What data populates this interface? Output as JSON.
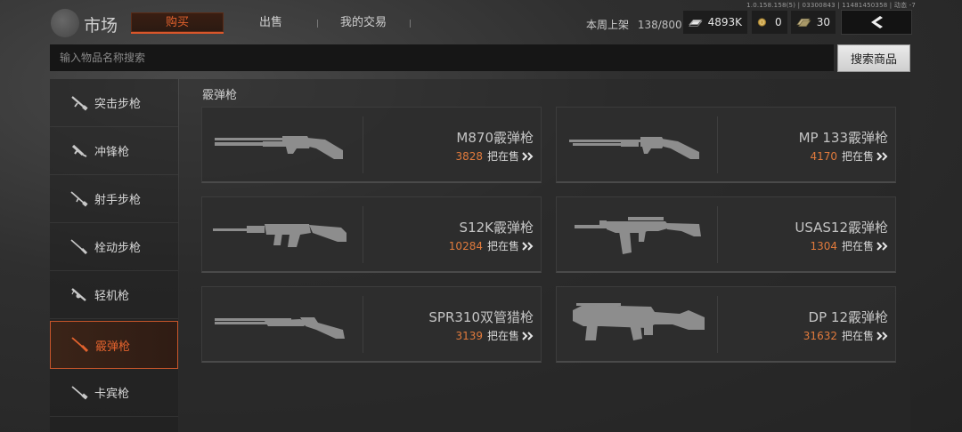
{
  "version_text": "1.0.158.158(5) | 03300843 | 11481450358 | 动态 -7",
  "header": {
    "title": "市场",
    "tabs": [
      {
        "label": "购买",
        "active": true
      },
      {
        "label": "出售",
        "active": false
      },
      {
        "label": "我的交易",
        "active": false
      }
    ],
    "weekly_listing_label": "本周上架",
    "weekly_listing_value": "138/800",
    "currencies": [
      {
        "icon": "cash-stack-icon",
        "value": "4893K"
      },
      {
        "icon": "gold-coin-icon",
        "value": "0"
      },
      {
        "icon": "ticket-bundle-icon",
        "value": "30"
      }
    ]
  },
  "search": {
    "placeholder": "输入物品名称搜索",
    "button_label": "搜索商品"
  },
  "sidebar": {
    "items": [
      {
        "label": "突击步枪",
        "icon": "assault-rifle-icon",
        "active": false
      },
      {
        "label": "冲锋枪",
        "icon": "smg-icon",
        "active": false
      },
      {
        "label": "射手步枪",
        "icon": "marksman-rifle-icon",
        "active": false
      },
      {
        "label": "栓动步枪",
        "icon": "bolt-action-rifle-icon",
        "active": false
      },
      {
        "label": "轻机枪",
        "icon": "lmg-icon",
        "active": false
      },
      {
        "label": "霰弹枪",
        "icon": "shotgun-icon",
        "active": true
      },
      {
        "label": "卡宾枪",
        "icon": "carbine-icon",
        "active": false
      }
    ]
  },
  "main": {
    "section_title": "霰弹枪",
    "on_sale_suffix": "把在售",
    "items": [
      {
        "name": "M870霰弹枪",
        "count": "3828",
        "icon": "pump-shotgun-icon"
      },
      {
        "name": "MP 133霰弹枪",
        "count": "4170",
        "icon": "pump-shotgun-icon"
      },
      {
        "name": "S12K霰弹枪",
        "count": "10284",
        "icon": "semi-auto-shotgun-icon"
      },
      {
        "name": "USAS12霰弹枪",
        "count": "1304",
        "icon": "auto-shotgun-icon"
      },
      {
        "name": "SPR310双管猎枪",
        "count": "3139",
        "icon": "double-barrel-shotgun-icon"
      },
      {
        "name": "DP 12霰弹枪",
        "count": "31632",
        "icon": "bullpup-shotgun-icon"
      }
    ]
  },
  "colors": {
    "accent": "#e2622d",
    "price": "#e07a3c"
  }
}
